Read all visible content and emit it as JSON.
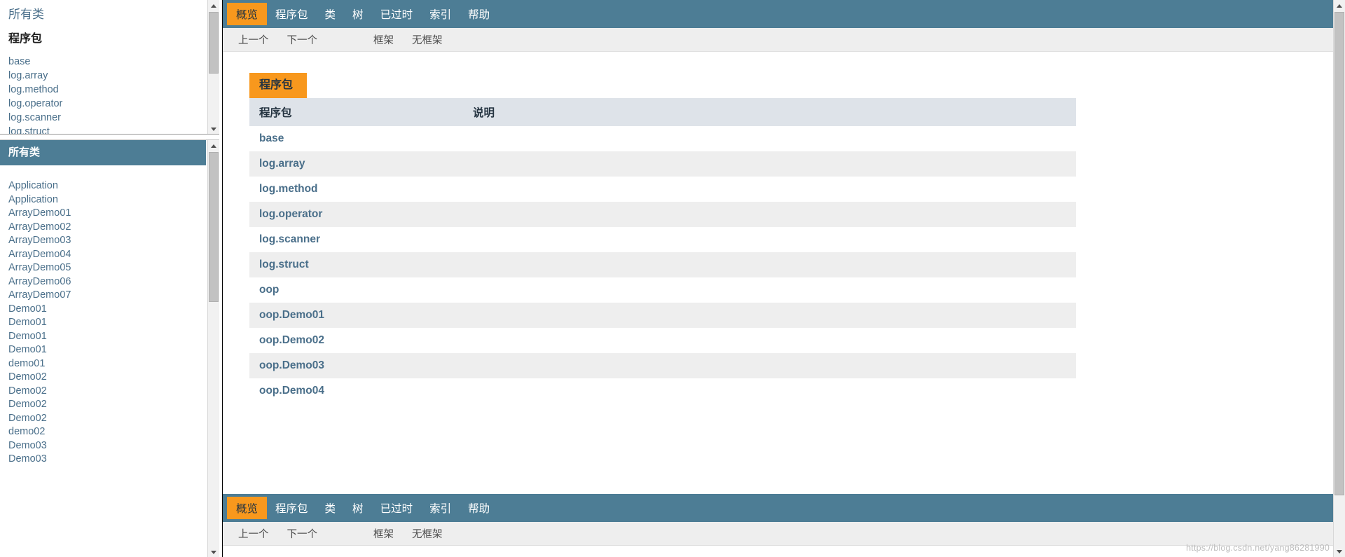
{
  "package_frame": {
    "overview_link": "所有类",
    "heading": "程序包",
    "packages": [
      "base",
      "log.array",
      "log.method",
      "log.operator",
      "log.scanner",
      "log.struct"
    ]
  },
  "class_frame": {
    "title": "所有类",
    "classes": [
      "Application",
      "Application",
      "ArrayDemo01",
      "ArrayDemo02",
      "ArrayDemo03",
      "ArrayDemo04",
      "ArrayDemo05",
      "ArrayDemo06",
      "ArrayDemo07",
      "Demo01",
      "Demo01",
      "Demo01",
      "Demo01",
      "demo01",
      "Demo02",
      "Demo02",
      "Demo02",
      "Demo02",
      "demo02",
      "Demo03",
      "Demo03"
    ]
  },
  "nav": {
    "tabs": [
      {
        "label": "概览",
        "active": true
      },
      {
        "label": "程序包",
        "active": false
      },
      {
        "label": "类",
        "active": false
      },
      {
        "label": "树",
        "active": false
      },
      {
        "label": "已过时",
        "active": false
      },
      {
        "label": "索引",
        "active": false
      },
      {
        "label": "帮助",
        "active": false
      }
    ],
    "sub_left": [
      "上一个",
      "下一个"
    ],
    "sub_right": [
      "框架",
      "无框架"
    ]
  },
  "main": {
    "caption": "程序包",
    "columns": [
      "程序包",
      "说明"
    ],
    "rows": [
      {
        "package": "base",
        "description": ""
      },
      {
        "package": "log.array",
        "description": ""
      },
      {
        "package": "log.method",
        "description": ""
      },
      {
        "package": "log.operator",
        "description": ""
      },
      {
        "package": "log.scanner",
        "description": ""
      },
      {
        "package": "log.struct",
        "description": ""
      },
      {
        "package": "oop",
        "description": ""
      },
      {
        "package": "oop.Demo01",
        "description": ""
      },
      {
        "package": "oop.Demo02",
        "description": ""
      },
      {
        "package": "oop.Demo03",
        "description": ""
      },
      {
        "package": "oop.Demo04",
        "description": ""
      }
    ]
  },
  "watermark": "https://blog.csdn.net/yang86281990",
  "colors": {
    "nav_bg": "#4d7d95",
    "accent": "#f8981d",
    "link": "#4a6f8a",
    "table_header_bg": "#dee3e9",
    "alt_row_bg": "#eeeeee"
  }
}
